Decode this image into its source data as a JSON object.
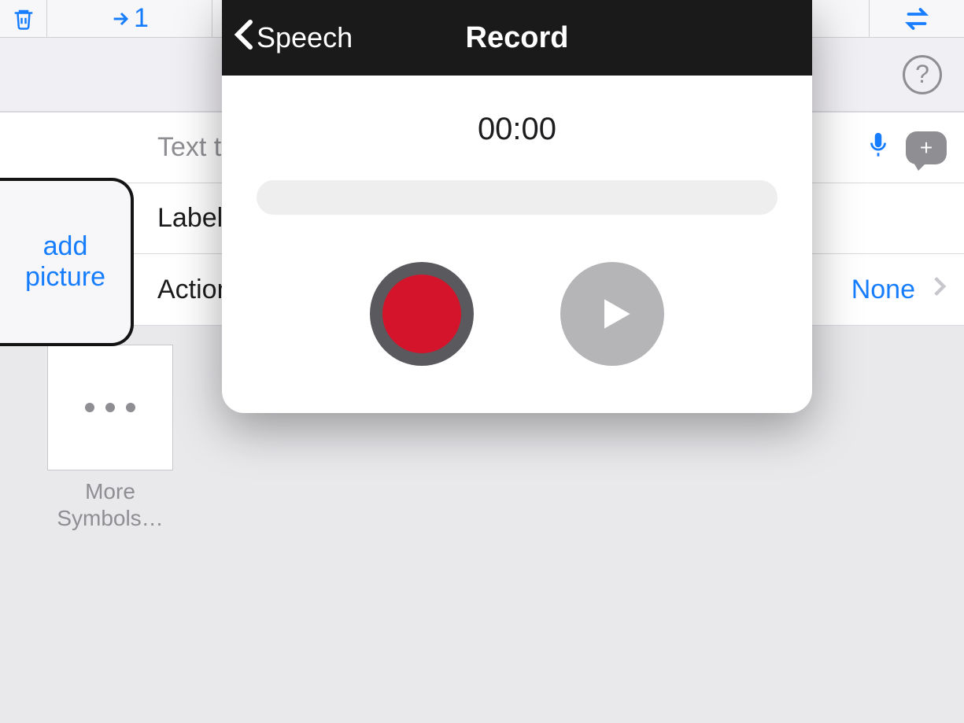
{
  "toolbar": {
    "step_label": "1"
  },
  "form": {
    "add_picture": "add\npicture",
    "text_to_speak": "Text t",
    "label_row": "Label",
    "actions_row": "Action",
    "actions_value": "None"
  },
  "symbols": {
    "tile_caption": "More Symbols…"
  },
  "modal": {
    "back_label": "Speech",
    "title": "Record",
    "timer": "00:00"
  }
}
